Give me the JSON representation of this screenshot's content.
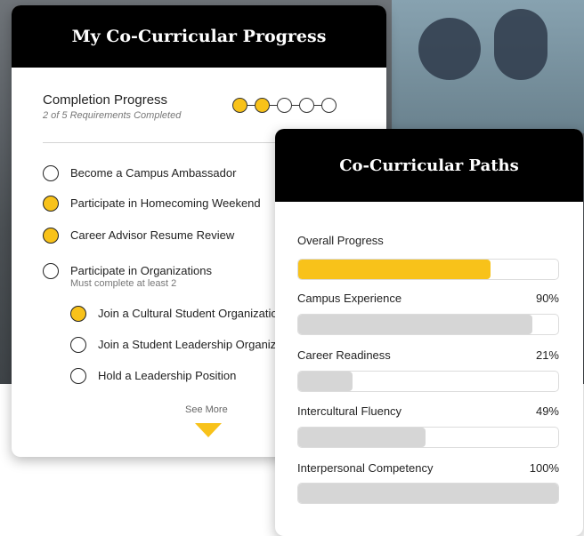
{
  "left_card": {
    "title": "My Co-Curricular Progress",
    "completion_title": "Completion Progress",
    "completion_sub": "2 of 5 Requirements Completed",
    "progress_dots": [
      true,
      true,
      false,
      false,
      false
    ],
    "requirements": [
      {
        "label": "Become a Campus Ambassador",
        "done": false
      },
      {
        "label": "Participate in Homecoming Weekend",
        "done": true
      },
      {
        "label": "Career Advisor Resume Review",
        "done": true
      },
      {
        "label": "Participate in Organizations",
        "done": false,
        "note": "Must complete at least 2"
      }
    ],
    "sub_requirements": [
      {
        "label": "Join a Cultural Student Organization",
        "done": true
      },
      {
        "label": "Join a Student Leadership Organization",
        "done": false
      },
      {
        "label": "Hold a Leadership Position",
        "done": false
      }
    ],
    "see_more": "See More"
  },
  "right_card": {
    "title": "Co-Curricular Paths",
    "overall_label": "Overall Progress",
    "overall_value": 0.74,
    "paths": [
      {
        "label": "Campus Experience",
        "pct": "90%",
        "value": 0.9
      },
      {
        "label": "Career Readiness",
        "pct": "21%",
        "value": 0.21
      },
      {
        "label": "Intercultural Fluency",
        "pct": "49%",
        "value": 0.49
      },
      {
        "label": "Interpersonal Competency",
        "pct": "100%",
        "value": 1.0
      }
    ]
  },
  "colors": {
    "accent": "#f8c21a",
    "header": "#000000",
    "bar_gray": "#d6d6d6"
  }
}
